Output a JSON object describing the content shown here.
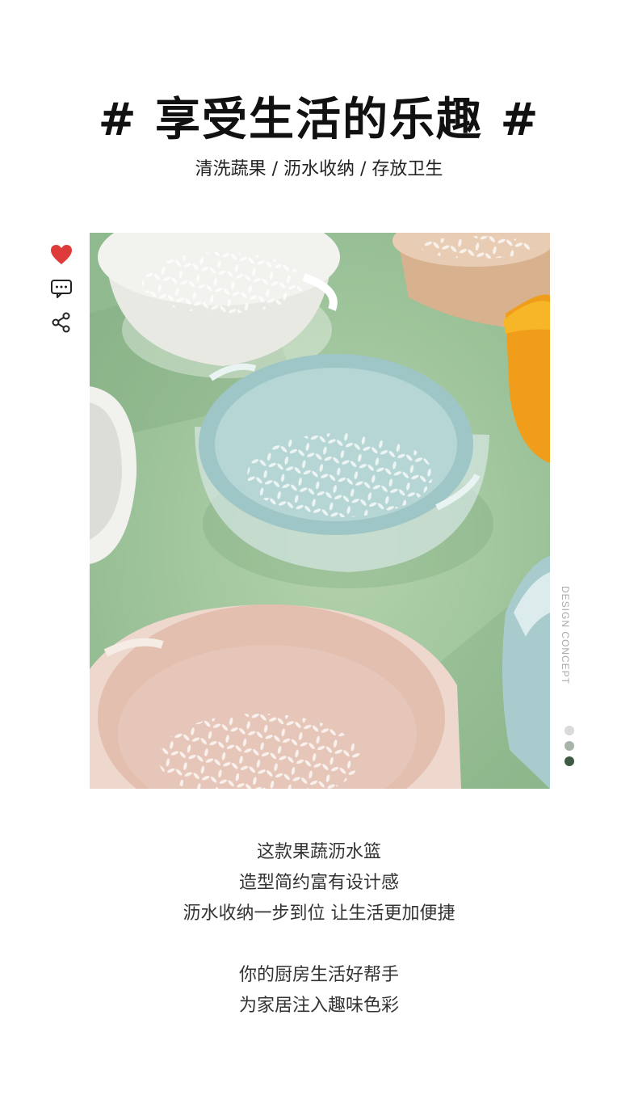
{
  "headline": "# 享受生活的乐趣 #",
  "subline": "清洗蔬果 / 沥水收纳 / 存放卫生",
  "side_icons": [
    "heart-icon",
    "comment-icon",
    "share-icon"
  ],
  "vertical_label": "DESIGN CONCEPT",
  "pager": {
    "count": 3,
    "active_index": 2,
    "colors": [
      "#d9dbd8",
      "#a9b4a8",
      "#3f5a43"
    ]
  },
  "description": {
    "paragraph1": [
      "这款果蔬沥水篮",
      "造型简约富有设计感",
      "沥水收纳一步到位 让生活更加便捷"
    ],
    "paragraph2": [
      "你的厨房生活好帮手",
      "为家居注入趣味色彩"
    ]
  },
  "colors": {
    "heart": "#e03b3b",
    "background_green": "#9bc199",
    "basket_blue": "#a8cccd",
    "basket_pink": "#e6c4b5",
    "basket_white": "#eeeeea",
    "basket_orange": "#f0a41e",
    "basket_tan": "#d8b28f"
  }
}
